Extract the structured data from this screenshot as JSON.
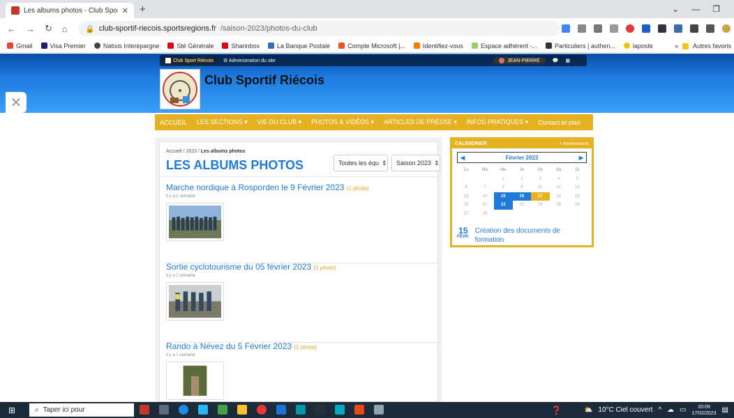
{
  "browser": {
    "tab_title": "Les albums photos - Club Sportif",
    "url_domain": "club-sportif-riecois.sportsregions.fr",
    "url_path": "/saison-2023/photos-du-club",
    "bookmarks": [
      "Gmail",
      "Visa Premier",
      "Natixis Interépargne",
      "Sté Générale",
      "Sharinbox",
      "La Banque Postale",
      "Compte Microsoft |...",
      "Identifiez-vous",
      "Espace adhérent -...",
      "Particuliers | authen...",
      "laposte"
    ],
    "bookmarks_more": "»",
    "other_bookmarks": "Autres favoris"
  },
  "site": {
    "topbar_club": "Club Sport Riécois",
    "topbar_admin": "Administration du site",
    "topbar_user": "JEAN-PIERRE",
    "title": "Club Sportif Riécois",
    "nav": [
      "ACCUEIL",
      "LES SECTIONS ▾",
      "VIE DU CLUB ▾",
      "PHOTOS & VIDÉOS ▾",
      "ARTICLES DE PRESSE ▾",
      "INFOS PRATIQUES ▾",
      "Contact et plan"
    ]
  },
  "page": {
    "crumbs": [
      "Accueil",
      "/",
      "2023",
      "/",
      "Les albums photos"
    ],
    "title": "LES ALBUMS PHOTOS",
    "filter_section": "Toutes les équ",
    "filter_season": "Saison 2023",
    "posts": [
      {
        "title": "Marche nordique à Rosporden le 9 Février 2023",
        "count": "(1 photo)",
        "ago": "Il y a 1 semaine"
      },
      {
        "title": "Sortie cyclotourisme du 05 février 2023",
        "count": "(1 photo)",
        "ago": "Il y a 1 semaine"
      },
      {
        "title": "Rando à Névez du 5 Février 2023",
        "count": "(1 photo)",
        "ago": "Il y a 1 semaine"
      }
    ]
  },
  "calendar": {
    "header": "CALENDRIER",
    "header_link": "+ d'événements",
    "month": "Février 2023",
    "weekdays": [
      "Lu",
      "Ma",
      "Me",
      "Je",
      "Ve",
      "Sa",
      "Di"
    ],
    "weeks": [
      [
        "",
        "",
        "1",
        "2",
        "3",
        "4",
        "5"
      ],
      [
        "6",
        "7",
        "8",
        "9",
        "10",
        "11",
        "12"
      ],
      [
        "13",
        "14",
        "15",
        "16",
        "17",
        "18",
        "19"
      ],
      [
        "20",
        "21",
        "22",
        "23",
        "24",
        "25",
        "26"
      ],
      [
        "27",
        "28",
        "",
        "",
        "",
        "",
        ""
      ]
    ],
    "event_day": "15",
    "event_month": "FÉVR.",
    "event_title": "Création des documents de formation"
  },
  "taskbar": {
    "search_placeholder": "Taper ici pour",
    "weather": "10°C Ciel couvert",
    "time": "20:09",
    "date": "17/02/2023"
  }
}
